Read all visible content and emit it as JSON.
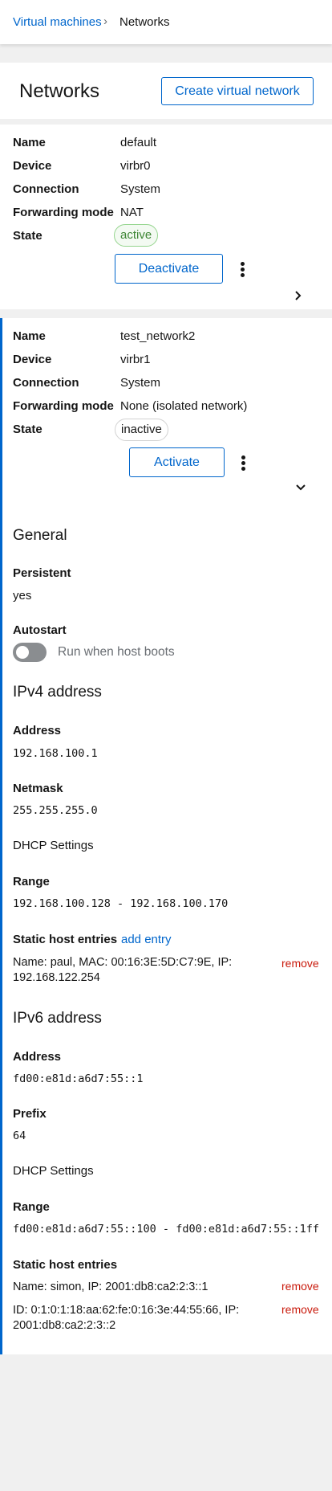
{
  "breadcrumb": {
    "parent": "Virtual machines",
    "separator": "›",
    "current": "Networks"
  },
  "header": {
    "title": "Networks",
    "create_button": "Create virtual network"
  },
  "field_labels": {
    "name": "Name",
    "device": "Device",
    "connection": "Connection",
    "forwarding": "Forwarding mode",
    "state": "State"
  },
  "networks": [
    {
      "name": "default",
      "device": "virbr0",
      "connection": "System",
      "forwarding": "NAT",
      "state": "active",
      "action": "Deactivate",
      "expanded": false
    },
    {
      "name": "test_network2",
      "device": "virbr1",
      "connection": "System",
      "forwarding": "None (isolated network)",
      "state": "inactive",
      "action": "Activate",
      "expanded": true
    }
  ],
  "details": {
    "general": {
      "title": "General",
      "persistent_label": "Persistent",
      "persistent_value": "yes",
      "autostart_label": "Autostart",
      "autostart_toggle_label": "Run when host boots",
      "autostart_on": false
    },
    "ipv4": {
      "title": "IPv4 address",
      "address_label": "Address",
      "address": "192.168.100.1",
      "netmask_label": "Netmask",
      "netmask": "255.255.255.0",
      "dhcp_label": "DHCP Settings",
      "range_label": "Range",
      "range": "192.168.100.128 - 192.168.100.170",
      "static_label": "Static host entries",
      "add_entry": "add entry",
      "entries": [
        {
          "text": "Name: paul, MAC: 00:16:3E:5D:C7:9E, IP: 192.168.122.254",
          "remove": "remove"
        }
      ]
    },
    "ipv6": {
      "title": "IPv6 address",
      "address_label": "Address",
      "address": "fd00:e81d:a6d7:55::1",
      "prefix_label": "Prefix",
      "prefix": "64",
      "dhcp_label": "DHCP Settings",
      "range_label": "Range",
      "range": "fd00:e81d:a6d7:55::100 - fd00:e81d:a6d7:55::1ff",
      "static_label": "Static host entries",
      "entries": [
        {
          "text": "Name: simon, IP: 2001:db8:ca2:2:3::1",
          "remove": "remove"
        },
        {
          "text": "ID: 0:1:0:1:18:aa:62:fe:0:16:3e:44:55:66, IP: 2001:db8:ca2:2:3::2",
          "remove": "remove"
        }
      ]
    }
  },
  "colors": {
    "link": "#0066cc",
    "active_green": "#3e8635",
    "remove_red": "#c9190b",
    "expanded_border": "#0066cc"
  }
}
